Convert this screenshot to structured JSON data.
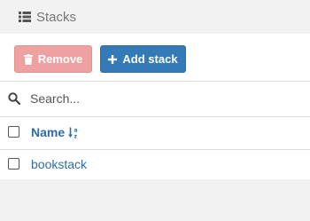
{
  "header": {
    "title": "Stacks",
    "icon": "list-icon"
  },
  "actions": {
    "remove_label": "Remove",
    "remove_icon": "trash-icon",
    "add_label": "Add stack",
    "add_icon": "plus-icon"
  },
  "search": {
    "placeholder": "Search...",
    "value": "",
    "icon": "search-icon"
  },
  "table": {
    "columns": [
      {
        "label": "Name",
        "sort_icon": "sort-alpha-icon"
      }
    ],
    "rows": [
      {
        "name": "bookstack",
        "checked": false
      }
    ]
  },
  "colors": {
    "primary": "#337ab7",
    "danger_disabled": "#eea1a0",
    "link": "#2d6da3",
    "header_text": "#767676"
  }
}
